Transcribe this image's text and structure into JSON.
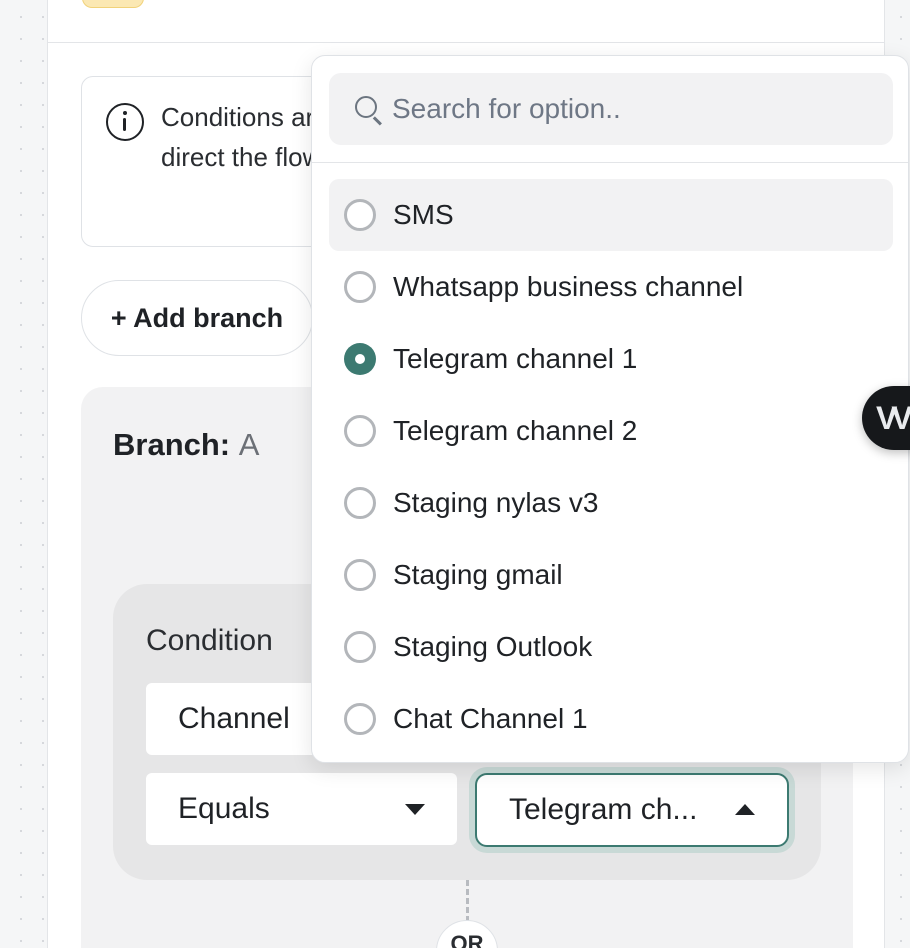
{
  "info": {
    "text": "Conditions are evaluated in order to direct the flow of the workflow"
  },
  "add_branch_label": "+ Add branch",
  "branch": {
    "label": "Branch:",
    "name": "A",
    "condition": {
      "title": "Condition",
      "field": "Channel",
      "operator": "Equals",
      "value": "Telegram ch..."
    }
  },
  "or_label": "OR",
  "dropdown": {
    "search_placeholder": "Search for option..",
    "search_value": "",
    "options": [
      {
        "label": "SMS",
        "selected": false
      },
      {
        "label": "Whatsapp business channel",
        "selected": false
      },
      {
        "label": "Telegram channel 1",
        "selected": true
      },
      {
        "label": "Telegram channel 2",
        "selected": false
      },
      {
        "label": "Staging nylas v3",
        "selected": false
      },
      {
        "label": "Staging gmail",
        "selected": false
      },
      {
        "label": "Staging Outlook",
        "selected": false
      },
      {
        "label": "Chat Channel 1",
        "selected": false
      }
    ]
  },
  "colors": {
    "accent": "#3c7a71",
    "panel": "#ffffff",
    "branch_bg": "#f2f2f3",
    "condition_bg": "#e6e6e7"
  },
  "icons": [
    "info-icon",
    "search-icon",
    "chevron-down-icon",
    "chevron-up-icon",
    "assistant-logo-icon"
  ]
}
